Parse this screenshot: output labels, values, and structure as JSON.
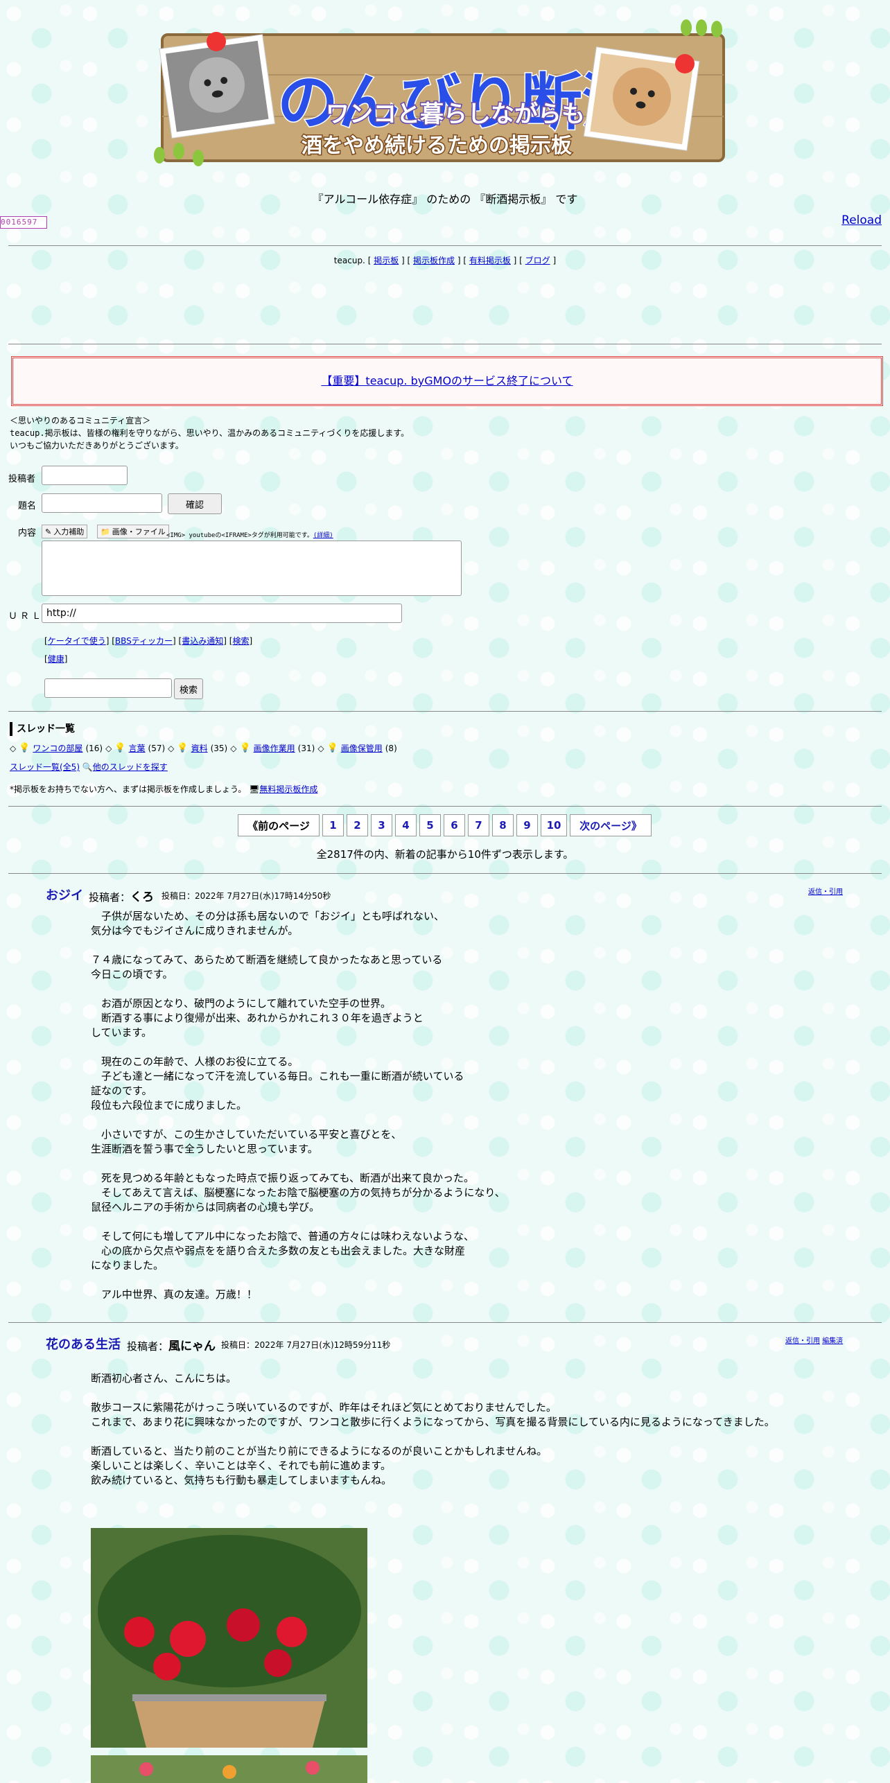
{
  "banner": {
    "title": "のんびり断酒",
    "subtitle1": "ワンコと暮らしながらも",
    "subtitle2": "酒をやめ続けるための掲示板"
  },
  "tagline": "『アルコール依存症』 のための 『断酒掲示板』 です",
  "counter": "0016597",
  "reload": "Reload",
  "teacup_nav": {
    "prefix": "teacup.",
    "links": [
      "掲示板",
      "掲示板作成",
      "有料掲示板",
      "ブログ"
    ]
  },
  "notice": "【重要】teacup. byGMOのサービス終了について",
  "declaration": {
    "heading": "＜思いやりのあるコミュニティ宣言＞",
    "line1_brand": "teacup.",
    "line1": "掲示板は、皆様の権利を守りながら、思いやり、温かみのあるコミュニティづくりを応援します。",
    "line2": "いつもご協力いただきありがとうございます。"
  },
  "form": {
    "poster_label": "投稿者",
    "title_label": "題名",
    "confirm_button": "確認",
    "body_label": "内容",
    "input_assist": "入力補助",
    "image_file": "画像・ファイル",
    "tag_note": "<IMG> youtubeの<IFRAME>タグが利用可能です。",
    "tag_detail": "(詳細)",
    "url_label": "ＵＲＬ",
    "url_value": "http://",
    "links1": [
      "ケータイで使う",
      "BBSティッカー",
      "書込み通知",
      "検索"
    ],
    "links2": [
      "健康"
    ],
    "search_button": "検索"
  },
  "threads": {
    "title": "スレッド一覧",
    "items": [
      {
        "name": "ワンコの部屋",
        "count": "(16)"
      },
      {
        "name": "言葉",
        "count": "(57)"
      },
      {
        "name": "資料",
        "count": "(35)"
      },
      {
        "name": "画像作業用",
        "count": "(31)"
      },
      {
        "name": "画像保管用",
        "count": "(8)"
      }
    ],
    "all_link": "スレッド一覧(全5)",
    "other_link": "他のスレッドを探す"
  },
  "bbs_promo": {
    "text": "*掲示板をお持ちでない方へ、まずは掲示板を作成しましょう。",
    "link": "無料掲示板作成"
  },
  "pager": {
    "prev": "《前のページ",
    "pages": [
      "1",
      "2",
      "3",
      "4",
      "5",
      "6",
      "7",
      "8",
      "9",
      "10"
    ],
    "next": "次のページ》"
  },
  "total": "全2817件の内、新着の記事から10件ずつ表示します。",
  "posts": [
    {
      "title": "おジイ",
      "poster_label": "投稿者：",
      "poster": "くろ",
      "posted": "投稿日：2022年 7月27日(水)17時14分50秒",
      "actions": "返信・引用",
      "body": "　子供が居ないため、その分は孫も居ないので「おジイ」とも呼ばれない、\n気分は今でもジイさんに成りきれませんが。\n\n７４歳になってみて、あらためて断酒を継続して良かったなあと思っている\n今日この頃です。\n\n　お酒が原因となり、破門のようにして離れていた空手の世界。\n　断酒する事により復帰が出来、あれからかれこれ３０年を過ぎようと\nしています。\n\n　現在のこの年齢で、人様のお役に立てる。\n　子ども達と一緒になって汗を流している毎日。これも一重に断酒が続いている\n証なのです。\n段位も六段位までに成りました。\n\n　小さいですが、この生かさしていただいている平安と喜びとを、\n生涯断酒を誓う事で全うしたいと思っています。\n\n　死を見つめる年齢ともなった時点で振り返ってみても、断酒が出来て良かった。\n　そしてあえて言えば、脳梗塞になったお陰で脳梗塞の方の気持ちが分かるようになり、\n鼠径ヘルニアの手術からは同病者の心境も学び。\n\n　そして何にも増してアル中になったお陰で、普通の方々には味わえないような、\n　心の底から欠点や弱点をを語り合えた多数の友とも出会えました。大きな財産\nになりました。\n\n　アル中世界、真の友達。万歳！！"
    },
    {
      "title": "花のある生活",
      "poster_label": "投稿者：",
      "poster": "風にゃん",
      "posted": "投稿日：2022年 7月27日(水)12時59分11秒",
      "actions": "返信・引用",
      "actions2": "編集済",
      "body": "断酒初心者さん、こんにちは。\n\n散歩コースに紫陽花がけっこう咲いているのですが、昨年はそれほど気にとめておりませんでした。\nこれまで、あまり花に興味なかったのですが、ワンコと散歩に行くようになってから、写真を撮る背景にしている内に見るようになってきました。\n\n断酒していると、当たり前のことが当たり前にできるようになるのが良いことかもしれませんね。\n楽しいことは楽しく、辛いことは辛く、それでも前に進めます。\n飲み続けていると、気持ちも行動も暴走してしまいますもんね。"
    }
  ],
  "colors": {
    "link": "#0000cc",
    "post_title": "#1b1bb3",
    "notice_border": "#dd4444",
    "background": "#eefaf7"
  }
}
